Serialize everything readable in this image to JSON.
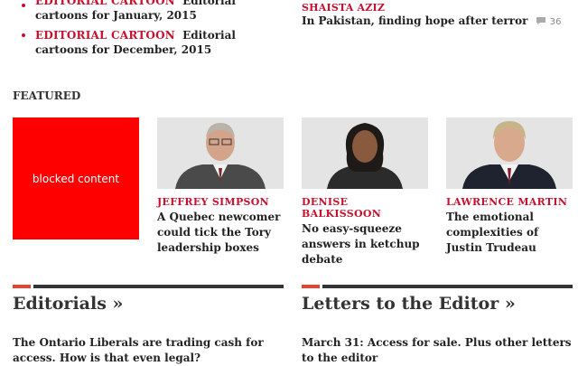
{
  "cartoons": [
    {
      "kicker": "EDITORIAL CARTOON",
      "text": "Editorial cartoons for January, 2015"
    },
    {
      "kicker": "EDITORIAL CARTOON",
      "text": "Editorial cartoons for December, 2015"
    }
  ],
  "right_story": {
    "author": "SHAISTA AZIZ",
    "headline": "In Pakistan, finding hope after terror",
    "comments": "36"
  },
  "featured": {
    "label": "FEATURED",
    "blocked_text": "blocked content",
    "cards": [
      {
        "author": "JEFFREY SIMPSON",
        "headline": "A Quebec newcomer could tick the Tory leadership boxes"
      },
      {
        "author": "DENISE BALKISSOON",
        "headline": "No easy-squeeze answers in ketchup debate"
      },
      {
        "author": "LAWRENCE MARTIN",
        "headline": "The emotional complexities of Justin Trudeau"
      }
    ]
  },
  "sections": [
    {
      "title": "Editorials »",
      "lead": "The Ontario Liberals are trading cash for access. How is that even legal?"
    },
    {
      "title": "Letters to the Editor »",
      "lead": "March 31: Access for sale. Plus other letters to the editor"
    }
  ],
  "colors": {
    "accent": "#c8102e",
    "blocked": "#ff0000",
    "bar_accent": "#e8412c",
    "bar_dark": "#333333"
  }
}
